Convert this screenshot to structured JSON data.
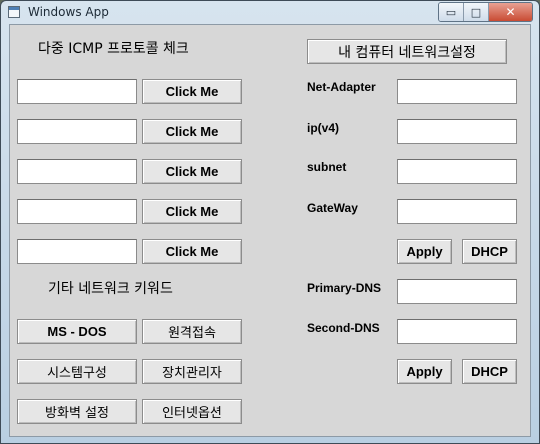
{
  "window": {
    "title": "Windows App",
    "minimize_glyph": "▭",
    "maximize_glyph": "□",
    "close_glyph": "✕"
  },
  "icmp": {
    "heading": "다중 ICMP 프로토콜 체크",
    "rows": [
      {
        "value": "",
        "button": "Click Me"
      },
      {
        "value": "",
        "button": "Click Me"
      },
      {
        "value": "",
        "button": "Click Me"
      },
      {
        "value": "",
        "button": "Click Me"
      },
      {
        "value": "",
        "button": "Click Me"
      }
    ]
  },
  "network": {
    "settings_button": "내 컴퓨터 네트워크설정",
    "net_adapter_label": "Net-Adapter",
    "ipv4_label": "ip(v4)",
    "subnet_label": "subnet",
    "gateway_label": "GateWay",
    "net_adapter_value": "",
    "ipv4_value": "",
    "subnet_value": "",
    "gateway_value": "",
    "apply_label": "Apply",
    "dhcp_label": "DHCP",
    "primary_dns_label": "Primary-DNS",
    "second_dns_label": "Second-DNS",
    "primary_dns_value": "",
    "second_dns_value": "",
    "dns_apply_label": "Apply",
    "dns_dhcp_label": "DHCP"
  },
  "keywords": {
    "heading": "기타 네트워크 키워드",
    "buttons": [
      "MS - DOS",
      "원격접속",
      "시스템구성",
      "장치관리자",
      "방화벽 설정",
      "인터넷옵션"
    ]
  }
}
